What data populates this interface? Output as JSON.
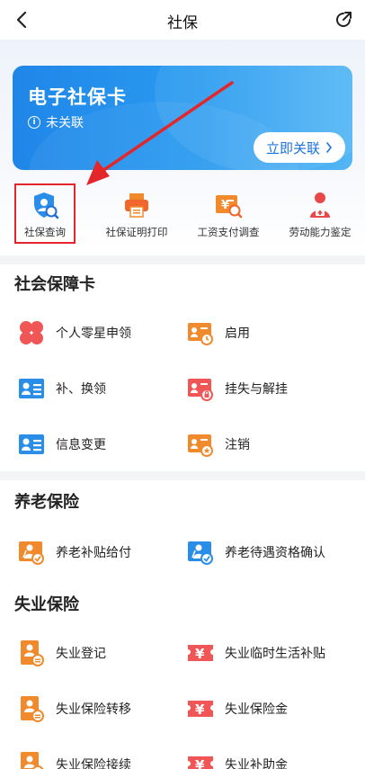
{
  "header": {
    "title": "社保",
    "back_icon": "back-chevron-icon",
    "share_icon": "share-icon"
  },
  "card": {
    "title": "电子社保卡",
    "status": "未关联",
    "link_button": "立即关联",
    "colors": {
      "start": "#1f86e8",
      "end": "#53b6f4"
    }
  },
  "quick_services": [
    {
      "label": "社保查询",
      "icon": "shield-search-icon",
      "highlighted": true
    },
    {
      "label": "社保证明打印",
      "icon": "printer-icon"
    },
    {
      "label": "工资支付调查",
      "icon": "payment-search-icon"
    },
    {
      "label": "劳动能力鉴定",
      "icon": "medical-person-icon"
    }
  ],
  "sections": [
    {
      "title": "社会保障卡",
      "items": [
        {
          "label": "个人零星申领",
          "icon": "petals-icon"
        },
        {
          "label": "启用",
          "icon": "card-clock-icon"
        },
        {
          "label": "补、换领",
          "icon": "id-card-icon"
        },
        {
          "label": "挂失与解挂",
          "icon": "card-lock-icon"
        },
        {
          "label": "信息变更",
          "icon": "id-card-icon"
        },
        {
          "label": "注销",
          "icon": "card-cancel-icon"
        }
      ]
    },
    {
      "title": "养老保险",
      "items": [
        {
          "label": "养老补贴给付",
          "icon": "elder-check-icon"
        },
        {
          "label": "养老待遇资格确认",
          "icon": "elder-verify-icon"
        }
      ]
    },
    {
      "title": "失业保险",
      "items": [
        {
          "label": "失业登记",
          "icon": "person-doc-icon"
        },
        {
          "label": "失业临时生活补贴",
          "icon": "yen-ticket-icon"
        },
        {
          "label": "失业保险转移",
          "icon": "person-doc-icon"
        },
        {
          "label": "失业保险金",
          "icon": "yen-ticket-icon"
        },
        {
          "label": "失业保险接续",
          "icon": "person-doc-icon"
        },
        {
          "label": "失业补助金",
          "icon": "yen-ticket-icon"
        }
      ]
    }
  ],
  "colors": {
    "accent_red": "#e3262a",
    "orange": "#f08a2c",
    "blue": "#2a8de8",
    "red_icon": "#f05656"
  }
}
